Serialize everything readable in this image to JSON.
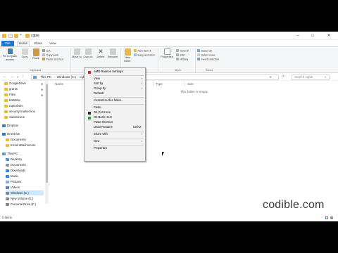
{
  "window": {
    "title": "cqble",
    "qa_prefix": "=",
    "min": "–",
    "max": "□",
    "close": "✕"
  },
  "ribbon": {
    "tabs": [
      "File",
      "Home",
      "Share",
      "View"
    ],
    "clipboard": {
      "pin": "Pin to Quick access",
      "copy": "Copy",
      "paste": "Paste",
      "cut": "Cut",
      "copy_path": "Copy path",
      "paste_shortcut": "Paste shortcut",
      "group": "Clipboard"
    },
    "organize": {
      "move_to": "Move to",
      "copy_to": "Copy to",
      "delete": "Delete",
      "rename": "Rename",
      "group": "Organize"
    },
    "new": {
      "new_folder": "New folder",
      "new_item": "New item ▾",
      "easy_access": "Easy access ▾",
      "group": "New"
    },
    "open": {
      "properties": "Properties",
      "open": "Open ▾",
      "edit": "Edit",
      "history": "History",
      "group": "Open"
    },
    "select": {
      "select_all": "Select all",
      "select_none": "Select none",
      "invert": "Invert selection",
      "group": "Select"
    }
  },
  "address": {
    "crumbs": [
      "This PC",
      "Windows (C:)",
      "cqble"
    ],
    "search_placeholder": "Search cqble"
  },
  "nav": {
    "quick": [
      "GoogleDrive",
      "grants",
      "Files",
      "batWrite",
      "raptorbets",
      "security market kno",
      "Submission"
    ],
    "dropbox": "Dropbox",
    "onedrive": "OneDrive",
    "onedrive_children": [
      "Documents",
      "Email attachments"
    ],
    "thispc": "This PC",
    "thispc_children": [
      "Desktop",
      "Documents",
      "Downloads",
      "Music",
      "Pictures",
      "Videos",
      "Windows (C:)",
      "New Volume (E:)",
      "Personal Drive (F:)"
    ]
  },
  "columns": [
    "Name",
    "Date modified",
    "Type",
    "Size"
  ],
  "empty_text": "This folder is empty.",
  "status": "0 items",
  "context_menu": {
    "header": "AMD Radeon Settings",
    "items": [
      {
        "label": "View",
        "arrow": "›"
      },
      {
        "label": "Sort by",
        "arrow": "›"
      },
      {
        "label": "Group by",
        "arrow": "›"
      },
      {
        "label": "Refresh"
      },
      {
        "label": "Customize this folder..."
      },
      {
        "label": "Paste"
      },
      {
        "label": "Git GUI Here"
      },
      {
        "label": "Git Bash Here"
      },
      {
        "label": "Paste shortcut"
      },
      {
        "label": "Undo Rename",
        "shortcut": "Ctrl+Z"
      },
      {
        "label": "Share with",
        "arrow": "›"
      },
      {
        "label": "New",
        "arrow": "›"
      },
      {
        "label": "Properties"
      }
    ]
  },
  "watermark": "codible.com",
  "colors": {
    "accent": "#1979ca",
    "selection": "#cce8ff",
    "menu_bg": "#f2f2f2",
    "folder": "#e8b84a"
  }
}
